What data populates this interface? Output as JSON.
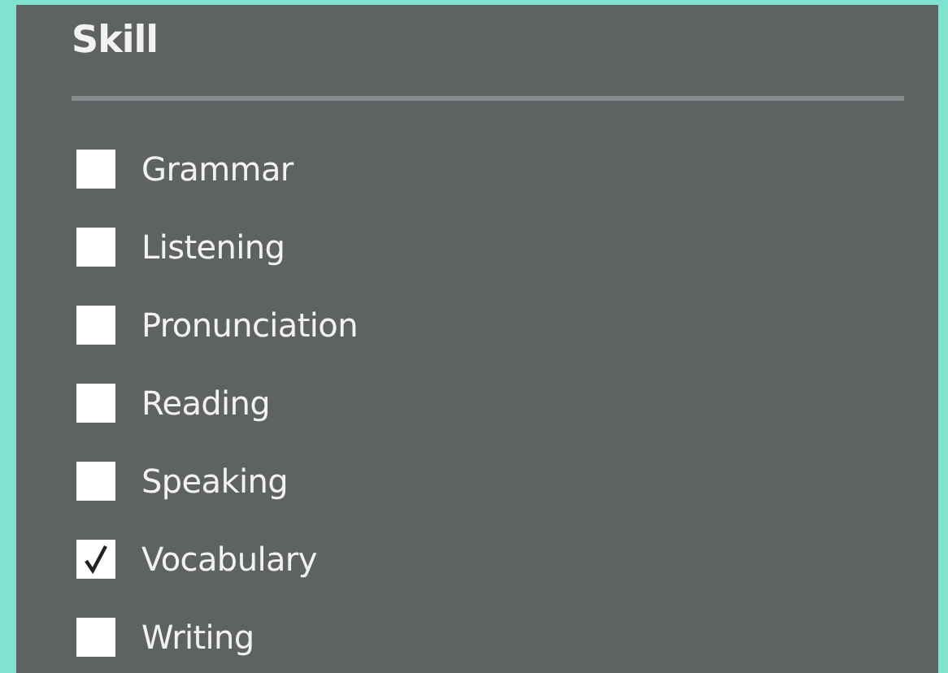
{
  "section": {
    "title": "Skill"
  },
  "options": [
    {
      "label": "Grammar",
      "checked": false
    },
    {
      "label": "Listening",
      "checked": false
    },
    {
      "label": "Pronunciation",
      "checked": false
    },
    {
      "label": "Reading",
      "checked": false
    },
    {
      "label": "Speaking",
      "checked": false
    },
    {
      "label": "Vocabulary",
      "checked": true
    },
    {
      "label": "Writing",
      "checked": false
    }
  ]
}
